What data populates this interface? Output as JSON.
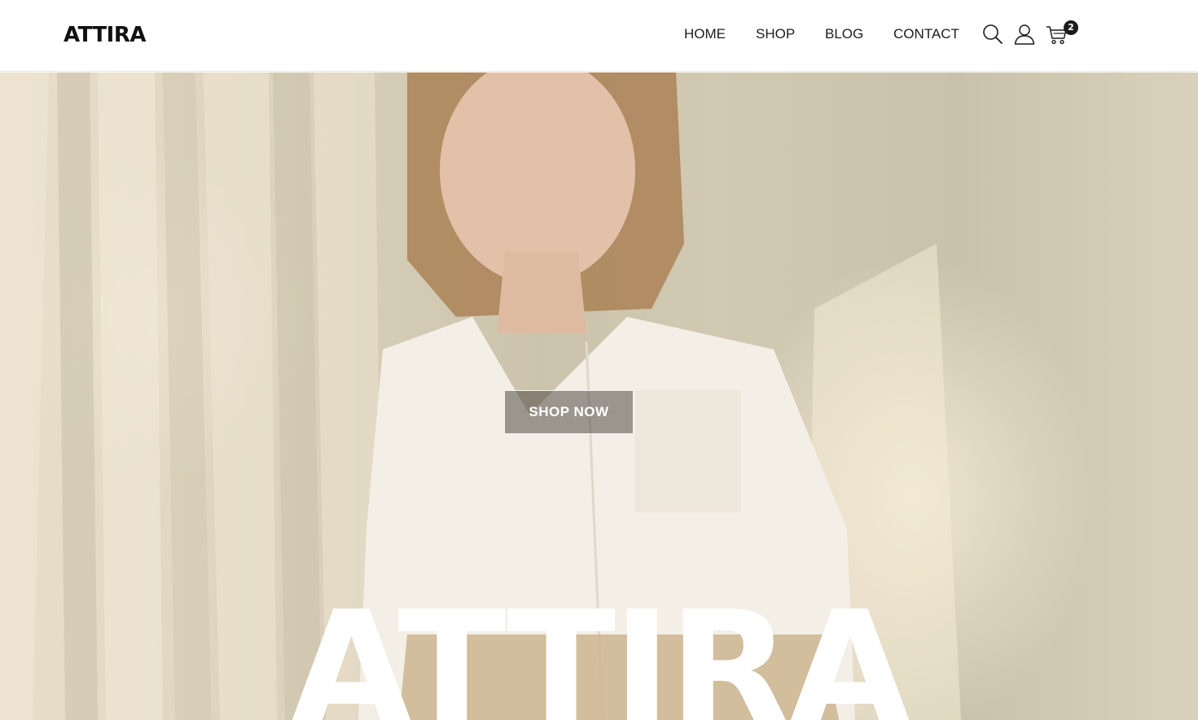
{
  "brand": {
    "logo_text": "ATTIRA"
  },
  "nav": {
    "items": [
      {
        "label": "HOME"
      },
      {
        "label": "SHOP"
      },
      {
        "label": "BLOG"
      },
      {
        "label": "CONTACT"
      }
    ]
  },
  "header_icons": {
    "search": "search-icon",
    "account": "user-icon",
    "cart": "cart-icon",
    "cart_count": "2"
  },
  "hero": {
    "cta_label": "SHOP NOW",
    "title": "ATTIRA"
  },
  "colors": {
    "text_dark": "#1c1c1c",
    "header_bg": "#ffffff",
    "hero_tone": "#d8cdb5",
    "overlay_text": "#ffffff"
  }
}
